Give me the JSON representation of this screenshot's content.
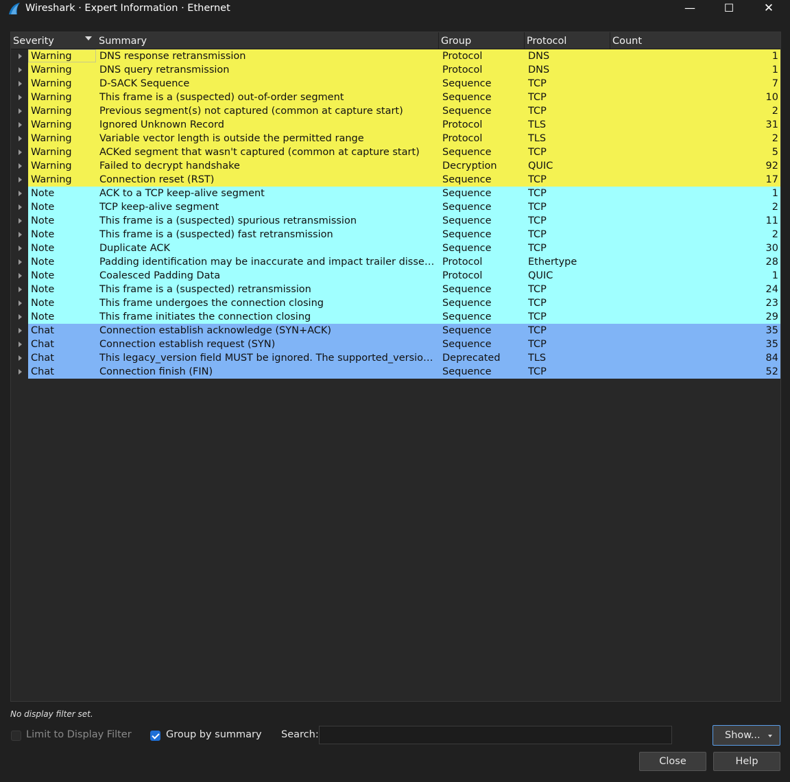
{
  "window": {
    "title": "Wireshark · Expert Information · Ethernet",
    "controls": {
      "minimize": "—",
      "maximize": "☐",
      "close": "✕"
    }
  },
  "table": {
    "columns": [
      "Severity",
      "Summary",
      "Group",
      "Protocol",
      "Count"
    ],
    "sort_column": "Severity",
    "rows": [
      {
        "severity": "Warning",
        "summary": "DNS response retransmission",
        "group": "Protocol",
        "protocol": "DNS",
        "count": "1"
      },
      {
        "severity": "Warning",
        "summary": "DNS query retransmission",
        "group": "Protocol",
        "protocol": "DNS",
        "count": "1"
      },
      {
        "severity": "Warning",
        "summary": "D-SACK Sequence",
        "group": "Sequence",
        "protocol": "TCP",
        "count": "7"
      },
      {
        "severity": "Warning",
        "summary": "This frame is a (suspected) out-of-order segment",
        "group": "Sequence",
        "protocol": "TCP",
        "count": "10"
      },
      {
        "severity": "Warning",
        "summary": "Previous segment(s) not captured (common at capture start)",
        "group": "Sequence",
        "protocol": "TCP",
        "count": "2"
      },
      {
        "severity": "Warning",
        "summary": "Ignored Unknown Record",
        "group": "Protocol",
        "protocol": "TLS",
        "count": "31"
      },
      {
        "severity": "Warning",
        "summary": "Variable vector length is outside the permitted range",
        "group": "Protocol",
        "protocol": "TLS",
        "count": "2"
      },
      {
        "severity": "Warning",
        "summary": "ACKed segment that wasn't captured (common at capture start)",
        "group": "Sequence",
        "protocol": "TCP",
        "count": "5"
      },
      {
        "severity": "Warning",
        "summary": "Failed to decrypt handshake",
        "group": "Decryption",
        "protocol": "QUIC",
        "count": "92"
      },
      {
        "severity": "Warning",
        "summary": "Connection reset (RST)",
        "group": "Sequence",
        "protocol": "TCP",
        "count": "17"
      },
      {
        "severity": "Note",
        "summary": "ACK to a TCP keep-alive segment",
        "group": "Sequence",
        "protocol": "TCP",
        "count": "1"
      },
      {
        "severity": "Note",
        "summary": "TCP keep-alive segment",
        "group": "Sequence",
        "protocol": "TCP",
        "count": "2"
      },
      {
        "severity": "Note",
        "summary": "This frame is a (suspected) spurious retransmission",
        "group": "Sequence",
        "protocol": "TCP",
        "count": "11"
      },
      {
        "severity": "Note",
        "summary": "This frame is a (suspected) fast retransmission",
        "group": "Sequence",
        "protocol": "TCP",
        "count": "2"
      },
      {
        "severity": "Note",
        "summary": "Duplicate ACK",
        "group": "Sequence",
        "protocol": "TCP",
        "count": "30"
      },
      {
        "severity": "Note",
        "summary": "Padding identification may be inaccurate and impact trailer dissector",
        "group": "Protocol",
        "protocol": "Ethertype",
        "count": "28"
      },
      {
        "severity": "Note",
        "summary": "Coalesced Padding Data",
        "group": "Protocol",
        "protocol": "QUIC",
        "count": "1"
      },
      {
        "severity": "Note",
        "summary": "This frame is a (suspected) retransmission",
        "group": "Sequence",
        "protocol": "TCP",
        "count": "24"
      },
      {
        "severity": "Note",
        "summary": "This frame undergoes the connection closing",
        "group": "Sequence",
        "protocol": "TCP",
        "count": "23"
      },
      {
        "severity": "Note",
        "summary": "This frame initiates the connection closing",
        "group": "Sequence",
        "protocol": "TCP",
        "count": "29"
      },
      {
        "severity": "Chat",
        "summary": "Connection establish acknowledge (SYN+ACK)",
        "group": "Sequence",
        "protocol": "TCP",
        "count": "35"
      },
      {
        "severity": "Chat",
        "summary": "Connection establish request (SYN)",
        "group": "Sequence",
        "protocol": "TCP",
        "count": "35"
      },
      {
        "severity": "Chat",
        "summary": "This legacy_version field MUST be ignored. The supported_versions exte...",
        "group": "Deprecated",
        "protocol": "TLS",
        "count": "84"
      },
      {
        "severity": "Chat",
        "summary": "Connection finish (FIN)",
        "group": "Sequence",
        "protocol": "TCP",
        "count": "52"
      }
    ]
  },
  "colors": {
    "warning": "#f4f252",
    "note": "#a0ffff",
    "chat": "#80b4f6",
    "accent": "#1e6fd6"
  },
  "footer": {
    "filter_status": "No display filter set.",
    "limit_label": "Limit to Display Filter",
    "limit_checked": false,
    "group_label": "Group by summary",
    "group_checked": true,
    "search_label": "Search:",
    "search_value": "",
    "show_button": "Show...",
    "close_button": "Close",
    "help_button": "Help"
  }
}
